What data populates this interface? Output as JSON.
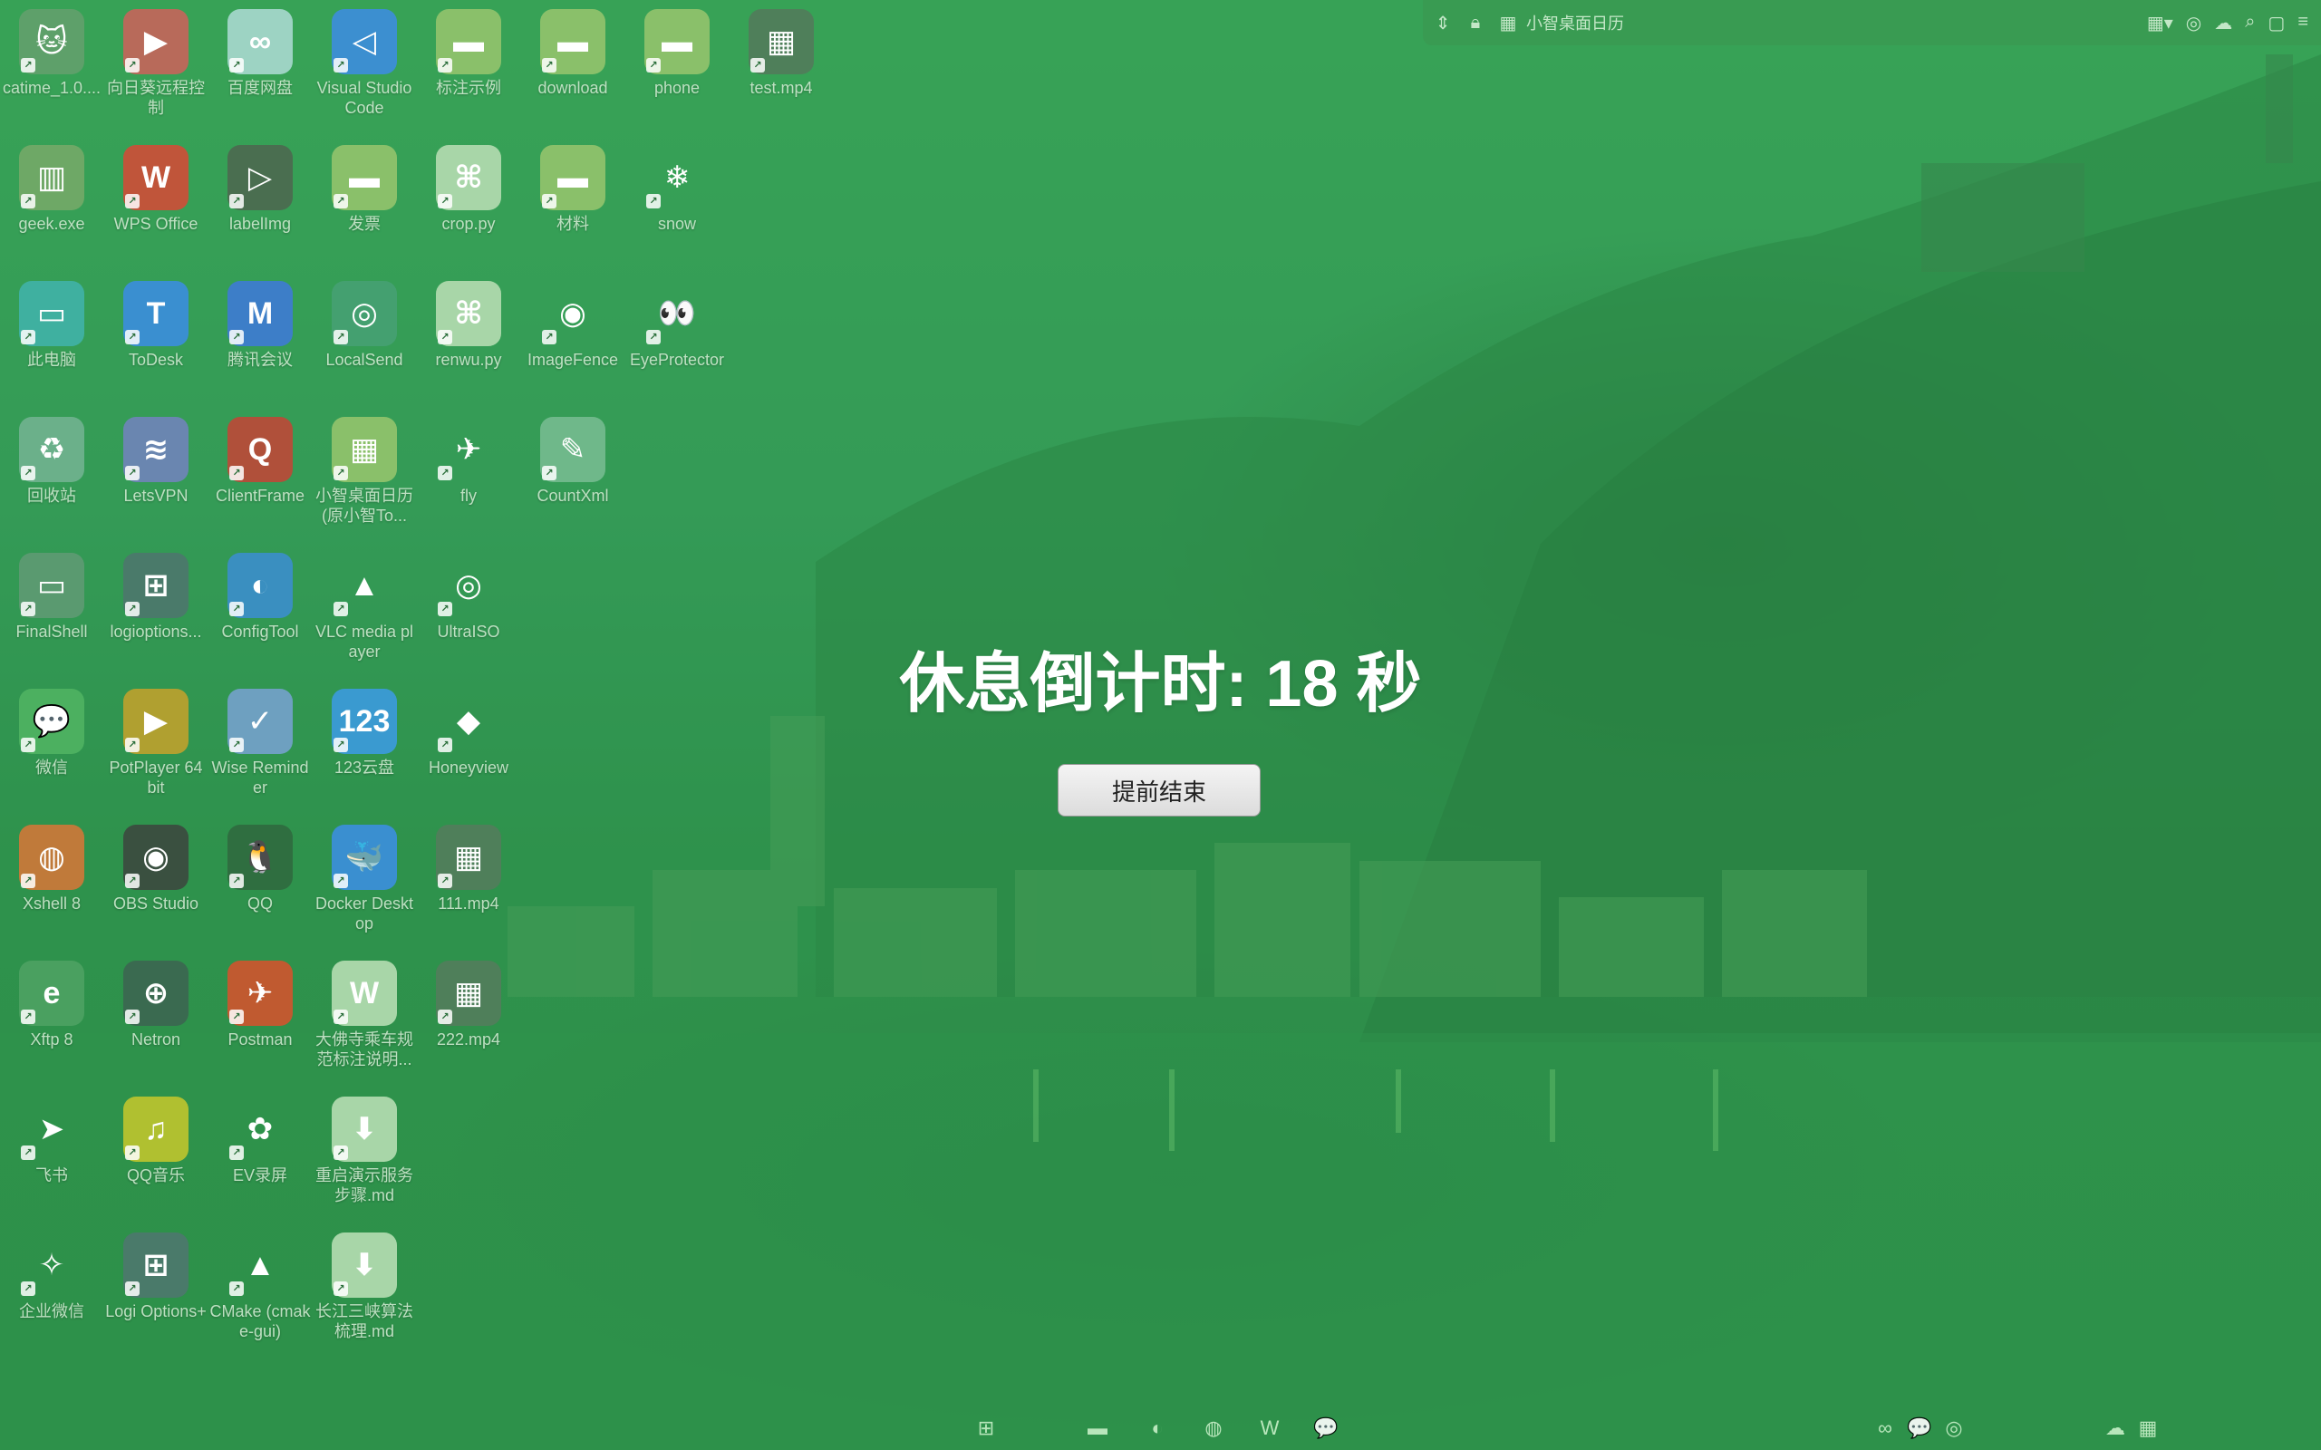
{
  "desktop_icons": [
    {
      "label": "catime_1.0....",
      "name": "catime-icon",
      "color": "#5ea06a",
      "glyph": "🐱"
    },
    {
      "label": "向日葵远程控制",
      "name": "sunflower-remote-icon",
      "color": "#b86a5a",
      "glyph": "▶"
    },
    {
      "label": "百度网盘",
      "name": "baidu-netdisk-icon",
      "color": "#9dd3c3",
      "glyph": "∞"
    },
    {
      "label": "Visual Studio Code",
      "name": "vscode-icon",
      "color": "#3c8fd0",
      "glyph": "◁"
    },
    {
      "label": "标注示例",
      "name": "folder-icon",
      "color": "#8ac06a",
      "glyph": "▬"
    },
    {
      "label": "download",
      "name": "folder-icon",
      "color": "#8ac06a",
      "glyph": "▬"
    },
    {
      "label": "phone",
      "name": "folder-icon",
      "color": "#8ac06a",
      "glyph": "▬"
    },
    {
      "label": "test.mp4",
      "name": "video-file-icon",
      "color": "#4f7f5a",
      "glyph": "▦"
    },
    {
      "label": "geek.exe",
      "name": "geek-icon",
      "color": "#6ea866",
      "glyph": "▥"
    },
    {
      "label": "WPS Office",
      "name": "wps-office-icon",
      "color": "#c0553a",
      "glyph": "W"
    },
    {
      "label": "labelImg",
      "name": "labelimg-icon",
      "color": "#4a6e50",
      "glyph": "▷"
    },
    {
      "label": "发票",
      "name": "folder-icon",
      "color": "#8ac06a",
      "glyph": "▬"
    },
    {
      "label": "crop.py",
      "name": "python-file-icon",
      "color": "#a8d6a8",
      "glyph": "⌘"
    },
    {
      "label": "材料",
      "name": "folder-icon",
      "color": "#8ac06a",
      "glyph": "▬"
    },
    {
      "label": "snow",
      "name": "snowflake-icon",
      "color": "transparent",
      "glyph": "❄"
    },
    {
      "label": "此电脑",
      "name": "this-pc-icon",
      "color": "#3fb0a0",
      "glyph": "▭"
    },
    {
      "label": "ToDesk",
      "name": "todesk-icon",
      "color": "#3a8fd0",
      "glyph": "T"
    },
    {
      "label": "腾讯会议",
      "name": "tencent-meeting-icon",
      "color": "#3d7ec8",
      "glyph": "M"
    },
    {
      "label": "LocalSend",
      "name": "localsend-icon",
      "color": "#44a070",
      "glyph": "◎"
    },
    {
      "label": "renwu.py",
      "name": "python-file-icon",
      "color": "#a8d6a8",
      "glyph": "⌘"
    },
    {
      "label": "ImageFence",
      "name": "imagefence-icon",
      "color": "transparent",
      "glyph": "◉"
    },
    {
      "label": "EyeProtector",
      "name": "eyeprotector-icon",
      "color": "transparent",
      "glyph": "👀"
    },
    {
      "label": "回收站",
      "name": "recycle-bin-icon",
      "color": "#6bb08a",
      "glyph": "♻"
    },
    {
      "label": "LetsVPN",
      "name": "letsvpn-icon",
      "color": "#6a86b0",
      "glyph": "≋"
    },
    {
      "label": "ClientFrame",
      "name": "clientframe-icon",
      "color": "#b0503a",
      "glyph": "Q"
    },
    {
      "label": "小智桌面日历(原小智To...",
      "name": "calendar-app-icon",
      "color": "#8ac06a",
      "glyph": "▦"
    },
    {
      "label": "fly",
      "name": "bird-icon",
      "color": "transparent",
      "glyph": "✈"
    },
    {
      "label": "CountXml",
      "name": "countxml-icon",
      "color": "#6fb88a",
      "glyph": "✎"
    },
    {
      "label": "FinalShell",
      "name": "finalshell-icon",
      "color": "#5a9a70",
      "glyph": "▭"
    },
    {
      "label": "logioptions...",
      "name": "logioptions-icon",
      "color": "#4a7a6a",
      "glyph": "⊞"
    },
    {
      "label": "ConfigTool",
      "name": "configtool-icon",
      "color": "#3a8fc0",
      "glyph": "◐"
    },
    {
      "label": "VLC media player",
      "name": "vlc-icon",
      "color": "transparent",
      "glyph": "▲"
    },
    {
      "label": "UltraISO",
      "name": "ultraiso-icon",
      "color": "transparent",
      "glyph": "◎"
    },
    {
      "label": "微信",
      "name": "wechat-icon",
      "color": "#4cb060",
      "glyph": "💬"
    },
    {
      "label": "PotPlayer 64 bit",
      "name": "potplayer-icon",
      "color": "#b0a030",
      "glyph": "▶"
    },
    {
      "label": "Wise Reminder",
      "name": "wise-reminder-icon",
      "color": "#6ea0c0",
      "glyph": "✓"
    },
    {
      "label": "123云盘",
      "name": "123pan-icon",
      "color": "#3a9ad0",
      "glyph": "123"
    },
    {
      "label": "Honeyview",
      "name": "honeyview-icon",
      "color": "transparent",
      "glyph": "◆"
    },
    {
      "label": "Xshell 8",
      "name": "xshell-icon",
      "color": "#c07a3a",
      "glyph": "◍"
    },
    {
      "label": "OBS Studio",
      "name": "obs-icon",
      "color": "#3a5040",
      "glyph": "◉"
    },
    {
      "label": "QQ",
      "name": "qq-icon",
      "color": "#2f6e40",
      "glyph": "🐧"
    },
    {
      "label": "Docker Desktop",
      "name": "docker-icon",
      "color": "#3a8fd0",
      "glyph": "🐳"
    },
    {
      "label": "111.mp4",
      "name": "video-file-icon",
      "color": "#4f7f5a",
      "glyph": "▦"
    },
    {
      "label": "Xftp 8",
      "name": "xftp-icon",
      "color": "#4aa060",
      "glyph": "e"
    },
    {
      "label": "Netron",
      "name": "netron-icon",
      "color": "#3a6a50",
      "glyph": "⊕"
    },
    {
      "label": "Postman",
      "name": "postman-icon",
      "color": "#c05a30",
      "glyph": "✈"
    },
    {
      "label": "大佛寺乘车规范标注说明...",
      "name": "word-doc-icon",
      "color": "#a8d6a8",
      "glyph": "W"
    },
    {
      "label": "222.mp4",
      "name": "video-file-icon",
      "color": "#4f7f5a",
      "glyph": "▦"
    },
    {
      "label": "飞书",
      "name": "feishu-icon",
      "color": "transparent",
      "glyph": "➤"
    },
    {
      "label": "QQ音乐",
      "name": "qq-music-icon",
      "color": "#b0c030",
      "glyph": "♫"
    },
    {
      "label": "EV录屏",
      "name": "ev-recorder-icon",
      "color": "transparent",
      "glyph": "✿"
    },
    {
      "label": "重启演示服务步骤.md",
      "name": "markdown-file-icon",
      "color": "#a8d6a8",
      "glyph": "⬇"
    },
    {
      "label": "企业微信",
      "name": "wecom-icon",
      "color": "transparent",
      "glyph": "✧"
    },
    {
      "label": "Logi Options+",
      "name": "logi-options-icon",
      "color": "#4a7a6a",
      "glyph": "⊞"
    },
    {
      "label": "CMake (cmake-gui)",
      "name": "cmake-icon",
      "color": "transparent",
      "glyph": "▲"
    },
    {
      "label": "长江三峡算法梳理.md",
      "name": "markdown-file-icon",
      "color": "#a8d6a8",
      "glyph": "⬇"
    }
  ],
  "topbar": {
    "title": "小智桌面日历"
  },
  "countdown": {
    "text": "休息倒计时: 18 秒"
  },
  "end_button": {
    "label": "提前结束"
  },
  "taskbar": {
    "items": [
      {
        "name": "start-icon",
        "glyph": "⊞"
      },
      {
        "name": "file-explorer-icon",
        "glyph": "▬"
      },
      {
        "name": "edge-icon",
        "glyph": "◐"
      },
      {
        "name": "xshell-taskbar-icon",
        "glyph": "◍"
      },
      {
        "name": "wps-taskbar-icon",
        "glyph": "W"
      },
      {
        "name": "wechat-taskbar-icon",
        "glyph": "💬"
      }
    ],
    "tray": [
      {
        "name": "eye-tray-icon",
        "glyph": "∞"
      },
      {
        "name": "wechat-tray-icon",
        "glyph": "💬"
      },
      {
        "name": "app-tray-icon",
        "glyph": "◎"
      },
      {
        "name": "network-tray-icon",
        "glyph": "☁"
      },
      {
        "name": "app2-tray-icon",
        "glyph": "▦"
      }
    ]
  },
  "colors": {
    "overlay": "#2ea050",
    "button_bg": "#e6e6e6",
    "countdown_text": "#ffffff"
  }
}
